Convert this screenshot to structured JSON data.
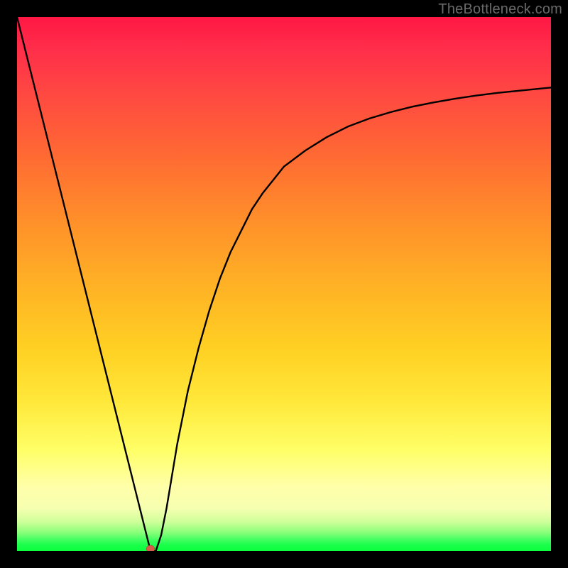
{
  "watermark": "TheBottleneck.com",
  "chart_data": {
    "type": "line",
    "title": "",
    "xlabel": "",
    "ylabel": "",
    "xlim": [
      0,
      100
    ],
    "ylim": [
      0,
      100
    ],
    "grid": false,
    "legend": false,
    "marker": {
      "x": 25,
      "y": 0,
      "color": "#d85a4a",
      "r": 5
    },
    "series": [
      {
        "name": "bottleneck-curve",
        "x": [
          0,
          2,
          4,
          6,
          8,
          10,
          12,
          14,
          16,
          18,
          20,
          21,
          22,
          23,
          24,
          25,
          26,
          27,
          28,
          29,
          30,
          32,
          34,
          36,
          38,
          40,
          42,
          44,
          46,
          48,
          50,
          54,
          58,
          62,
          66,
          70,
          74,
          78,
          82,
          86,
          90,
          94,
          98,
          100
        ],
        "values": [
          100,
          92,
          84,
          76,
          68,
          60,
          52,
          44,
          36,
          28,
          20,
          16,
          12,
          8,
          4,
          0,
          0,
          3,
          8,
          14,
          20,
          30,
          38,
          45,
          51,
          56,
          60,
          64,
          67,
          69.5,
          72,
          75,
          77.5,
          79.5,
          81,
          82.2,
          83.2,
          84,
          84.7,
          85.3,
          85.8,
          86.2,
          86.6,
          86.8
        ]
      }
    ]
  }
}
